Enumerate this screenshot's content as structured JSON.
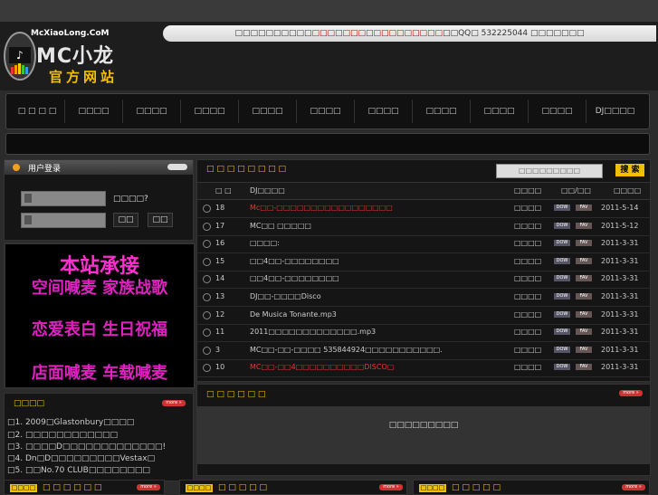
{
  "header": {
    "logo_small": "McXiaoLong.CoM",
    "logo_main": "MC小龙",
    "logo_sub": "官方网站",
    "notice_pre": "□□□□□□□□□□",
    "notice_red": "□□□□□□□□□□□□□□□□□",
    "notice_mid": "□□QQ□ 532225044",
    "notice_post": " □□□□□□□"
  },
  "nav": [
    "□ □ □ □",
    "□□□□",
    "□□□□",
    "□□□□",
    "□□□□",
    "□□□□",
    "□□□□",
    "□□□□",
    "□□□□",
    "□□□□",
    "DJ□□□□"
  ],
  "login": {
    "title": "用户登录",
    "forgot": "□□□□?",
    "btn_login": "□□",
    "btn_reg": "□□"
  },
  "promo": {
    "line1": "本站承接",
    "line2": "空间喊麦  家族战歌",
    "line3": "恋爱表白  生日祝福",
    "line4": "店面喊麦  车载喊麦"
  },
  "news": {
    "title": "□□□□",
    "more": "more »",
    "items": [
      "□1. 2009□Glastonbury□□□□",
      "□2. □□□□□□□□□□□□",
      "□3. □□□□D□□□□□□□□□□□□□!",
      "□4. Dn□D□□□□□□□□□Vestax□",
      "□5. □□No.70 CLUB□□□□□□□□"
    ]
  },
  "songs": {
    "title": "□ □ □ □ □ □ □ □",
    "search_placeholder": "□□□□□□□□□",
    "search_btn": "搜 索",
    "headers": {
      "num": "□ □",
      "name": "DJ□□□□",
      "dl": "□□□□",
      "op": "□□/□□",
      "date": "□□□□"
    },
    "rows": [
      {
        "num": "18",
        "name": "Mc□□-□□□□□□□□□□□□□□□□□",
        "dl": "□□□□",
        "date": "2011-5-14",
        "red": true
      },
      {
        "num": "17",
        "name": "MC□□ □□□□□",
        "dl": "□□□□",
        "date": "2011-5-12",
        "red": false
      },
      {
        "num": "16",
        "name": "□□□□:",
        "dl": "□□□□",
        "date": "2011-3-31",
        "red": false
      },
      {
        "num": "15",
        "name": "□□4□□-□□□□□□□□",
        "dl": "□□□□",
        "date": "2011-3-31",
        "red": false
      },
      {
        "num": "14",
        "name": "□□4□□-□□□□□□□□",
        "dl": "□□□□",
        "date": "2011-3-31",
        "red": false
      },
      {
        "num": "13",
        "name": "DJ□□-□□□□Disco",
        "dl": "□□□□",
        "date": "2011-3-31",
        "red": false
      },
      {
        "num": "12",
        "name": "De Musica Tonante.mp3",
        "dl": "□□□□",
        "date": "2011-3-31",
        "red": false
      },
      {
        "num": "11",
        "name": "2011□□□□□□□□□□□□□.mp3",
        "dl": "□□□□",
        "date": "2011-3-31",
        "red": false
      },
      {
        "num": "3",
        "name": "MC□□-□□-□□□□ 535844924□□□□□□□□□□□.",
        "dl": "□□□□",
        "date": "2011-3-31",
        "red": false
      },
      {
        "num": "10",
        "name": "MC□□-□□4□□□□□□□□□□DISCO□",
        "dl": "□□□□",
        "date": "2011-3-31",
        "red": true
      }
    ],
    "dow": "DOW",
    "fav": "FAV"
  },
  "box2": {
    "title": "□ □ □ □ □ □",
    "more": "more »",
    "text": "□□□□□□□□□"
  },
  "bottom": [
    {
      "tag": "□□□□",
      "title": "□ □ □ □ □ □",
      "more": "more »"
    },
    {
      "tag": "□□□□",
      "title": "□ □ □ □ □",
      "more": "more »"
    },
    {
      "tag": "□□□□",
      "title": "□ □ □ □ □",
      "more": "more »"
    }
  ]
}
